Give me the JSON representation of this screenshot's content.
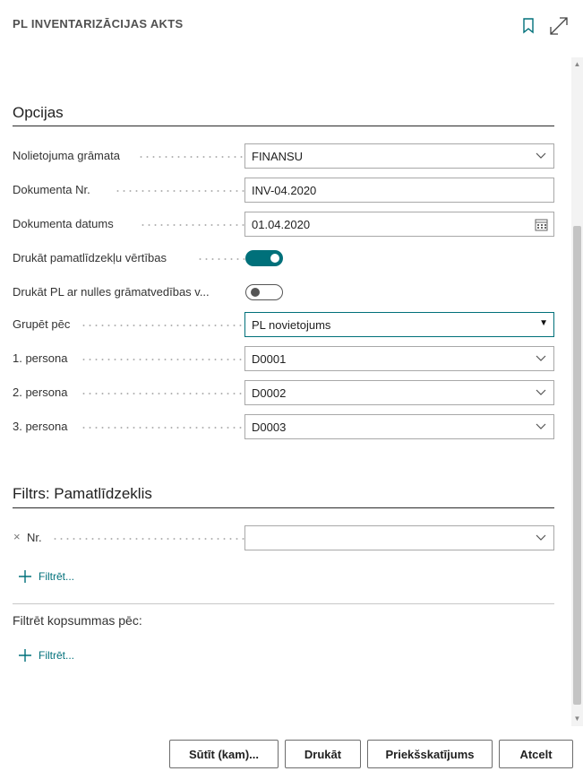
{
  "header": {
    "title": "PL INVENTARIZĀCIJAS AKTS",
    "bookmark_icon": "bookmark-icon",
    "expand_icon": "expand-icon"
  },
  "options": {
    "title": "Opcijas",
    "fields": [
      {
        "label": "Nolietojuma grāmata",
        "value": "FINANSU",
        "kind": "dropdown"
      },
      {
        "label": "Dokumenta Nr.",
        "value": "INV-04.2020",
        "kind": "text"
      },
      {
        "label": "Dokumenta datums",
        "value": "01.04.2020",
        "kind": "date"
      },
      {
        "label": "Drukāt pamatlīdzekļu vērtības",
        "value": "on",
        "kind": "toggle"
      },
      {
        "label": "Drukāt PL ar nulles grāmatvedības v...",
        "value": "off",
        "kind": "toggle"
      },
      {
        "label": "Grupēt pēc",
        "value": "PL novietojums",
        "kind": "select"
      },
      {
        "label": "1. persona",
        "value": "D0001",
        "kind": "dropdown"
      },
      {
        "label": "2. persona",
        "value": "D0002",
        "kind": "dropdown"
      },
      {
        "label": "3. persona",
        "value": "D0003",
        "kind": "dropdown"
      }
    ]
  },
  "filter": {
    "title": "Filtrs: Pamatlīdzeklis",
    "field_label": "Nr.",
    "field_value": "",
    "add_filter": "Filtrēt...",
    "totals_label": "Filtrēt kopsummas pēc:",
    "add_totals_filter": "Filtrēt..."
  },
  "buttons": {
    "send": "Sūtīt (kam)...",
    "print": "Drukāt",
    "preview": "Priekšskatījums",
    "cancel": "Atcelt"
  },
  "colors": {
    "accent": "#00707a"
  }
}
